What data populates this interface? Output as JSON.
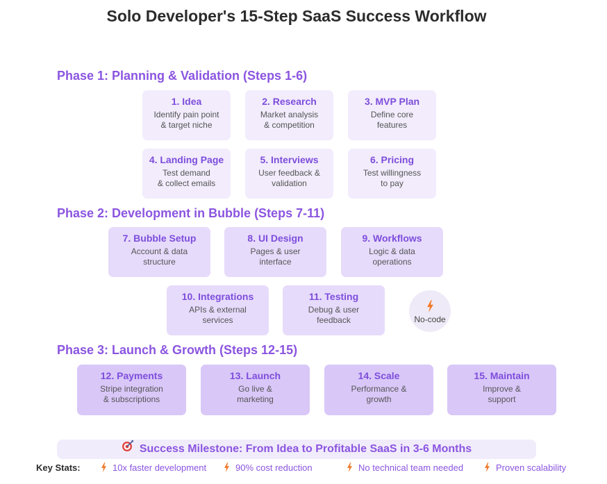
{
  "title": "Solo Developer's 15-Step SaaS Success Workflow",
  "phases": [
    {
      "title": "Phase 1: Planning & Validation (Steps 1-6)",
      "steps": [
        {
          "title": "1. Idea",
          "line1": "Identify pain point",
          "line2": "& target niche"
        },
        {
          "title": "2. Research",
          "line1": "Market analysis",
          "line2": "& competition"
        },
        {
          "title": "3. MVP Plan",
          "line1": "Define core",
          "line2": "features"
        },
        {
          "title": "4. Landing Page",
          "line1": "Test demand",
          "line2": "& collect emails"
        },
        {
          "title": "5. Interviews",
          "line1": "User feedback &",
          "line2": "validation"
        },
        {
          "title": "6. Pricing",
          "line1": "Test willingness",
          "line2": "to pay"
        }
      ]
    },
    {
      "title": "Phase 2: Development in Bubble (Steps 7-11)",
      "steps": [
        {
          "title": "7. Bubble Setup",
          "line1": "Account & data",
          "line2": "structure"
        },
        {
          "title": "8. UI Design",
          "line1": "Pages & user",
          "line2": "interface"
        },
        {
          "title": "9. Workflows",
          "line1": "Logic & data",
          "line2": "operations"
        },
        {
          "title": "10. Integrations",
          "line1": "APIs & external",
          "line2": "services"
        },
        {
          "title": "11. Testing",
          "line1": "Debug & user",
          "line2": "feedback"
        }
      ],
      "badge": {
        "icon": "lightning-icon",
        "label": "No-code"
      }
    },
    {
      "title": "Phase 3: Launch & Growth (Steps 12-15)",
      "steps": [
        {
          "title": "12. Payments",
          "line1": "Stripe integration",
          "line2": "& subscriptions"
        },
        {
          "title": "13. Launch",
          "line1": "Go live &",
          "line2": "marketing"
        },
        {
          "title": "14. Scale",
          "line1": "Performance &",
          "line2": "growth"
        },
        {
          "title": "15. Maintain",
          "line1": "Improve &",
          "line2": "support"
        }
      ]
    }
  ],
  "milestone": {
    "icon": "target-icon",
    "text": "Success Milestone: From Idea to Profitable SaaS in 3-6 Months"
  },
  "stats": {
    "label": "Key Stats:",
    "icon": "lightning-icon",
    "items": [
      "10x faster development",
      "90% cost reduction",
      "No technical team needed",
      "Proven scalability"
    ]
  },
  "colors": {
    "accent": "#8b55e0",
    "phase1_card": "#f2ecfc",
    "phase2_card": "#e6dbfb",
    "phase3_card": "#d9c7f8",
    "lightning": "#f07a2a"
  }
}
